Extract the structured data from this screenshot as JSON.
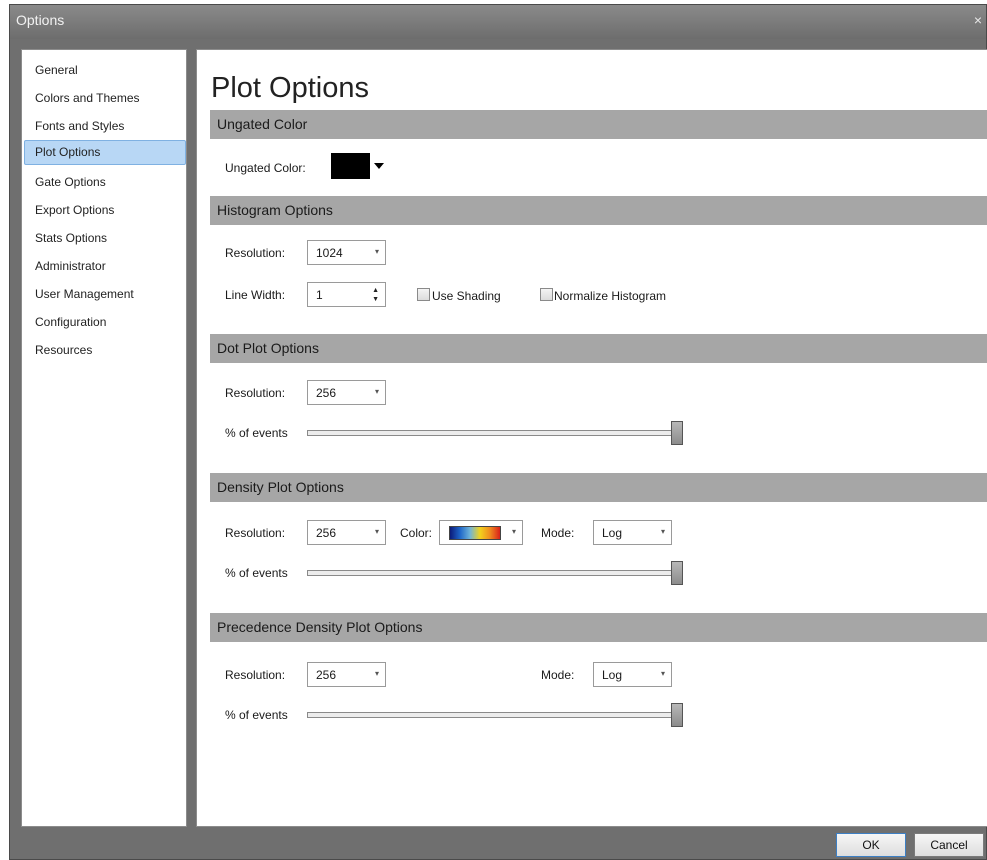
{
  "window": {
    "title": "Options",
    "close_glyph": "×"
  },
  "sidebar": {
    "items": [
      {
        "label": "General"
      },
      {
        "label": "Colors and Themes"
      },
      {
        "label": "Fonts and Styles"
      },
      {
        "label": "Plot Options",
        "selected": true
      },
      {
        "label": "Gate Options"
      },
      {
        "label": "Export Options"
      },
      {
        "label": "Stats Options"
      },
      {
        "label": "Administrator"
      },
      {
        "label": "User Management"
      },
      {
        "label": "Configuration"
      },
      {
        "label": "Resources"
      }
    ]
  },
  "page": {
    "title": "Plot Options"
  },
  "ungated": {
    "header": "Ungated Color",
    "color_label": "Ungated Color:",
    "color_value": "#000000"
  },
  "histogram": {
    "header": "Histogram Options",
    "resolution_label": "Resolution:",
    "resolution_value": "1024",
    "line_width_label": "Line Width:",
    "line_width_value": "1",
    "use_shading_label": "Use Shading",
    "use_shading_checked": false,
    "normalize_label": "Normalize Histogram",
    "normalize_checked": false
  },
  "dot_plot": {
    "header": "Dot Plot Options",
    "resolution_label": "Resolution:",
    "resolution_value": "256",
    "events_label": "% of events",
    "events_fraction": 1.0
  },
  "density_plot": {
    "header": "Density Plot Options",
    "resolution_label": "Resolution:",
    "resolution_value": "256",
    "color_label": "Color:",
    "color_palette": [
      "#0b1a7a",
      "#1e66c9",
      "#6fb4d9",
      "#f2d21d",
      "#f08b1f",
      "#d9201a"
    ],
    "mode_label": "Mode:",
    "mode_value": "Log",
    "events_label": "% of events",
    "events_fraction": 1.0
  },
  "precedence_plot": {
    "header": "Precedence Density Plot Options",
    "resolution_label": "Resolution:",
    "resolution_value": "256",
    "mode_label": "Mode:",
    "mode_value": "Log",
    "events_label": "% of events",
    "events_fraction": 1.0
  },
  "footer": {
    "ok_label": "OK",
    "cancel_label": "Cancel"
  },
  "icons": {
    "dropdown": "▾",
    "spinner_up": "▲",
    "spinner_down": "▼"
  },
  "colors": {
    "selected_nav": "#b8d7f5",
    "section_header": "#a6a6a6",
    "chrome": "#6f6f6f"
  }
}
